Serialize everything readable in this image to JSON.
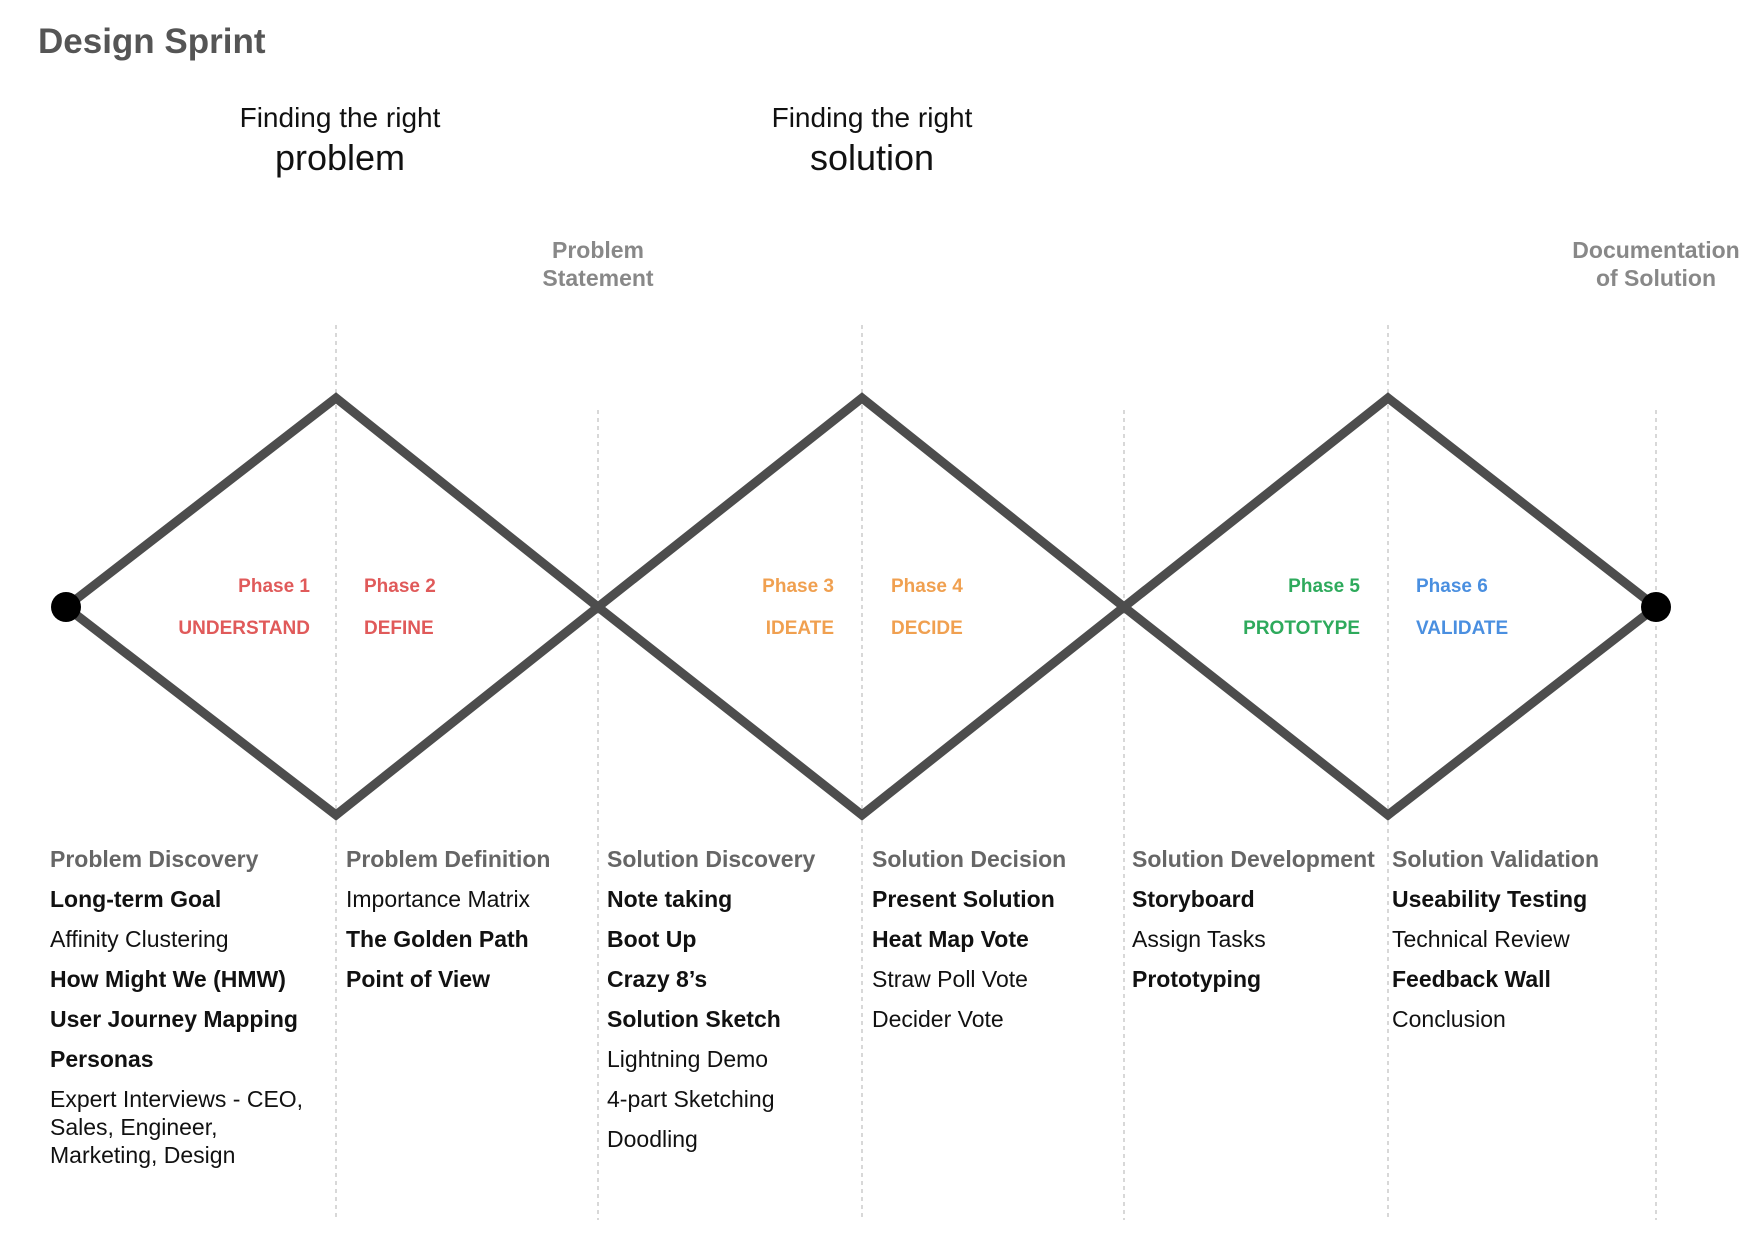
{
  "title": "Design Sprint",
  "headings": [
    {
      "line1": "Finding the right",
      "line2": "problem"
    },
    {
      "line1": "Finding the right",
      "line2": "solution"
    }
  ],
  "milestones": [
    {
      "line1": "Problem",
      "line2": "Statement"
    },
    {
      "line1": "Documentation",
      "line2": "of Solution"
    }
  ],
  "colors": {
    "red": "#e05a5a",
    "orange": "#f0a050",
    "green": "#2eaa5c",
    "blue": "#4a8fe0",
    "line": "#4d4d4d",
    "guide": "#cccccc"
  },
  "phases": [
    {
      "label": "Phase 1",
      "name": "UNDERSTAND",
      "color": "#e05a5a"
    },
    {
      "label": "Phase 2",
      "name": "DEFINE",
      "color": "#e05a5a"
    },
    {
      "label": "Phase 3",
      "name": "IDEATE",
      "color": "#f0a050"
    },
    {
      "label": "Phase 4",
      "name": "DECIDE",
      "color": "#f0a050"
    },
    {
      "label": "Phase 5",
      "name": "PROTOTYPE",
      "color": "#2eaa5c"
    },
    {
      "label": "Phase 6",
      "name": "VALIDATE",
      "color": "#4a8fe0"
    }
  ],
  "columns": [
    {
      "title": "Problem Discovery",
      "items": [
        {
          "text": "Long-term Goal",
          "bold": true
        },
        {
          "text": "Affinity Clustering",
          "bold": false
        },
        {
          "text": "How Might We (HMW)",
          "bold": true
        },
        {
          "text": "User Journey Mapping",
          "bold": true
        },
        {
          "text": "Personas",
          "bold": true
        },
        {
          "text": "Expert Interviews - CEO, Sales, Engineer, Marketing, Design",
          "bold": false
        }
      ]
    },
    {
      "title": "Problem Definition",
      "items": [
        {
          "text": "Importance Matrix",
          "bold": false
        },
        {
          "text": "The Golden Path",
          "bold": true
        },
        {
          "text": "Point of View",
          "bold": true
        }
      ]
    },
    {
      "title": "Solution Discovery",
      "items": [
        {
          "text": "Note taking",
          "bold": true
        },
        {
          "text": "Boot Up",
          "bold": true
        },
        {
          "text": "Crazy 8’s",
          "bold": true
        },
        {
          "text": "Solution Sketch",
          "bold": true
        },
        {
          "text": "Lightning Demo",
          "bold": false
        },
        {
          "text": "4-part Sketching",
          "bold": false
        },
        {
          "text": "Doodling",
          "bold": false
        }
      ]
    },
    {
      "title": "Solution Decision",
      "items": [
        {
          "text": "Present Solution",
          "bold": true
        },
        {
          "text": "Heat Map Vote",
          "bold": true
        },
        {
          "text": "Straw Poll Vote",
          "bold": false
        },
        {
          "text": "Decider Vote",
          "bold": false
        }
      ]
    },
    {
      "title": "Solution Development",
      "items": [
        {
          "text": "Storyboard",
          "bold": true
        },
        {
          "text": "Assign Tasks",
          "bold": false
        },
        {
          "text": "Prototyping",
          "bold": true
        }
      ]
    },
    {
      "title": "Solution Validation",
      "items": [
        {
          "text": "Useability Testing",
          "bold": true
        },
        {
          "text": "Technical Review",
          "bold": false
        },
        {
          "text": "Feedback Wall",
          "bold": true
        },
        {
          "text": "Conclusion",
          "bold": false
        }
      ]
    }
  ]
}
